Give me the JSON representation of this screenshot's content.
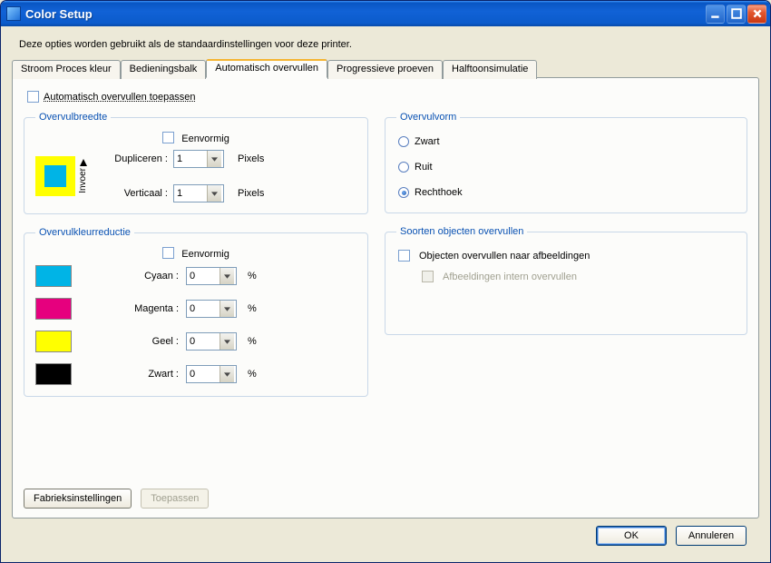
{
  "window": {
    "title": "Color Setup"
  },
  "intro": "Deze opties worden gebruikt als de standaardinstellingen voor deze printer.",
  "tabs": [
    {
      "label": "Stroom Proces kleur"
    },
    {
      "label": "Bedieningsbalk"
    },
    {
      "label": "Automatisch overvullen"
    },
    {
      "label": "Progressieve proeven"
    },
    {
      "label": "Halftoonsimulatie"
    }
  ],
  "auto_trap": {
    "apply_label": "Automatisch overvullen toepassen",
    "width_group": {
      "legend": "Overvulbreedte",
      "uniform_label": "Eenvormig",
      "invoer_label": "Invoer",
      "dup_label": "Dupliceren :",
      "dup_value": "1",
      "vert_label": "Verticaal :",
      "vert_value": "1",
      "unit": "Pixels"
    },
    "shape_group": {
      "legend": "Overvulvorm",
      "options": [
        {
          "label": "Zwart"
        },
        {
          "label": "Ruit"
        },
        {
          "label": "Rechthoek"
        }
      ],
      "selected": 2
    },
    "reduct_group": {
      "legend": "Overvulkleurreductie",
      "uniform_label": "Eenvormig",
      "unit": "%",
      "rows": [
        {
          "name": "Cyaan :",
          "value": "0",
          "swatch": "sw-c"
        },
        {
          "name": "Magenta :",
          "value": "0",
          "swatch": "sw-m"
        },
        {
          "name": "Geel :",
          "value": "0",
          "swatch": "sw-y"
        },
        {
          "name": "Zwart :",
          "value": "0",
          "swatch": "sw-k"
        }
      ]
    },
    "objects_group": {
      "legend": "Soorten objecten overvullen",
      "obj_to_img_label": "Objecten overvullen naar afbeeldingen",
      "internal_label": "Afbeeldingen intern overvullen"
    },
    "factory_btn": "Fabrieksinstellingen",
    "apply_btn": "Toepassen"
  },
  "footer": {
    "ok": "OK",
    "cancel": "Annuleren"
  }
}
